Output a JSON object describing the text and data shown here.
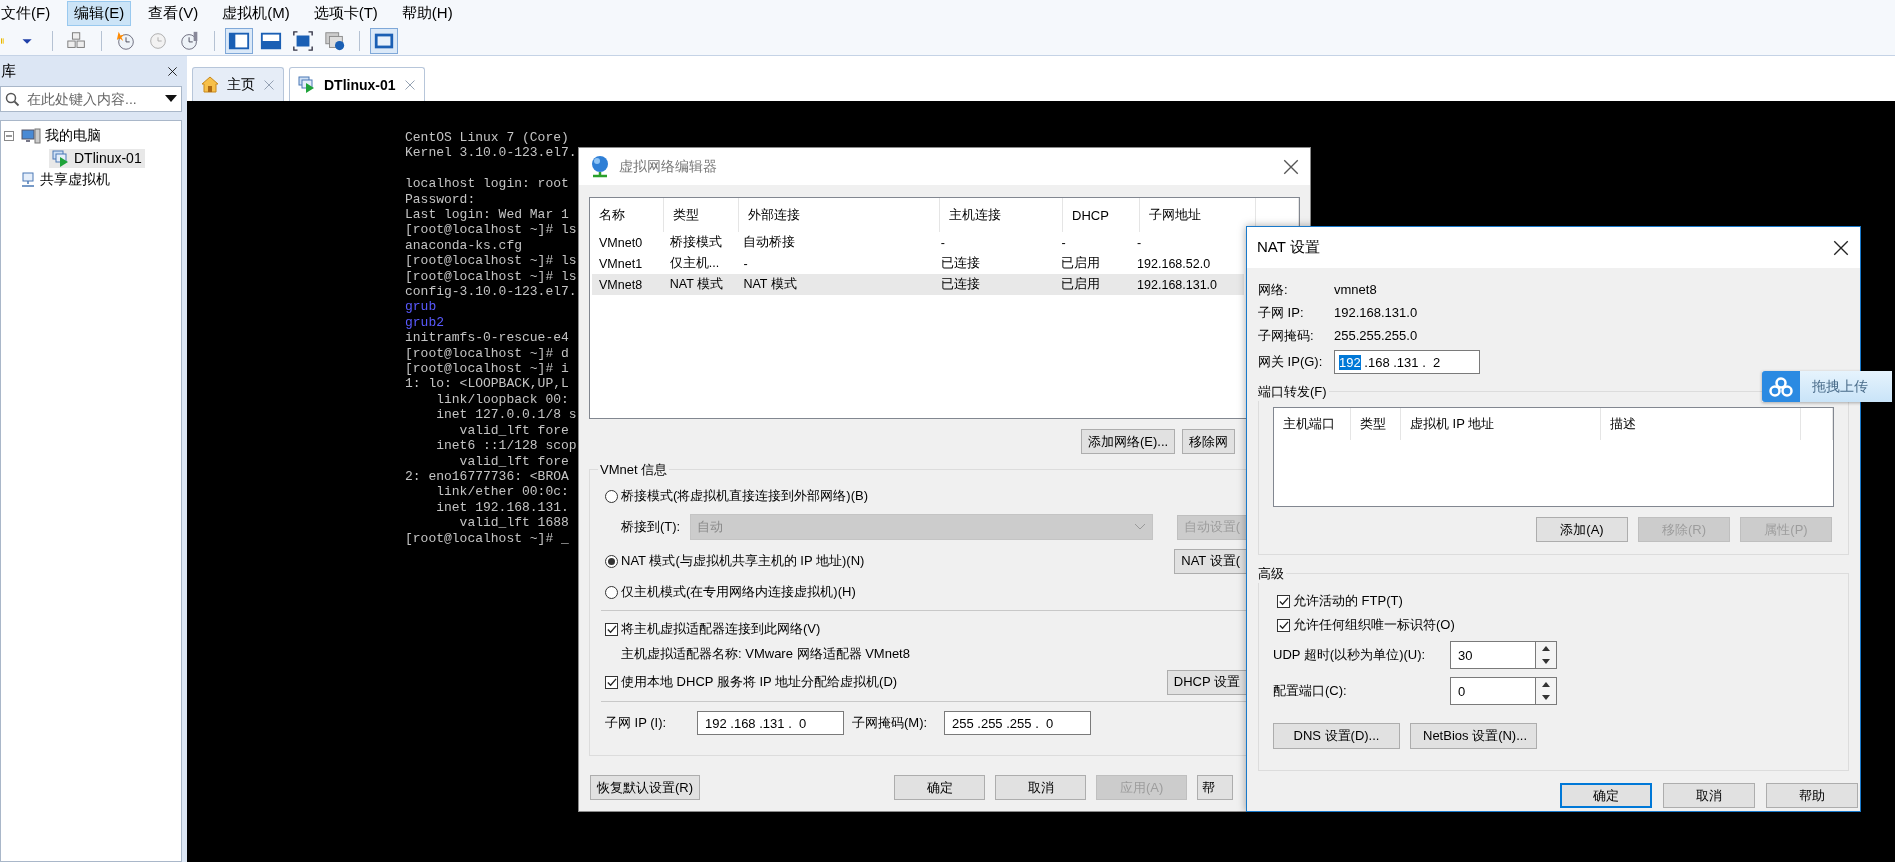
{
  "menu_bar": [
    {
      "label": "文件(F)",
      "selected": false
    },
    {
      "label": "编辑(E)",
      "selected": true
    },
    {
      "label": "查看(V)",
      "selected": false
    },
    {
      "label": "虚拟机(M)",
      "selected": false
    },
    {
      "label": "选项卡(T)",
      "selected": false
    },
    {
      "label": "帮助(H)",
      "selected": false
    }
  ],
  "toolbar": [
    [
      {
        "kind": "pause",
        "pressed": false
      },
      {
        "kind": "caret",
        "pressed": false
      }
    ],
    [
      {
        "kind": "network",
        "pressed": false
      }
    ],
    [
      {
        "kind": "snapshot",
        "pressed": false
      },
      {
        "kind": "revert",
        "pressed": false
      },
      {
        "kind": "manage",
        "pressed": false
      }
    ],
    [
      {
        "kind": "console",
        "pressed": true
      },
      {
        "kind": "split",
        "pressed": false
      },
      {
        "kind": "fullscreen",
        "pressed": false
      },
      {
        "kind": "unity",
        "pressed": false
      }
    ],
    [
      {
        "kind": "thumbnail",
        "pressed": true
      }
    ]
  ],
  "library": {
    "title": "库",
    "search": {
      "placeholder": "在此处键入内容..."
    },
    "tree": [
      {
        "label": "我的电脑",
        "kind": "computer",
        "selected": false,
        "expanded": true,
        "children": [
          {
            "label": "DTlinux-01",
            "kind": "vm",
            "selected": true
          }
        ]
      },
      {
        "label": "共享虚拟机",
        "kind": "shared",
        "selected": false
      }
    ]
  },
  "tabs": [
    {
      "label": "主页",
      "kind": "home",
      "selected": false
    },
    {
      "label": "DTlinux-01",
      "kind": "vm",
      "selected": true
    }
  ],
  "terminal": {
    "paragraphs": [
      [
        {
          "text": "CentOS Linux 7 (Core)",
          "kind": "text"
        },
        {
          "text": "Kernel 3.10.0-123.el7.",
          "kind": "text"
        }
      ],
      [
        {
          "text": "localhost login: root",
          "kind": "text"
        },
        {
          "text": "Password:",
          "kind": "text"
        },
        {
          "text": "Last login: Wed Mar 1",
          "kind": "text"
        },
        {
          "text": "[root@localhost ~]# ls",
          "kind": "text"
        },
        {
          "text": "anaconda-ks.cfg",
          "kind": "text"
        },
        {
          "text": "[root@localhost ~]# ls",
          "kind": "text"
        },
        {
          "text": "[root@localhost ~]# ls",
          "kind": "text"
        },
        {
          "text": "config-3.10.0-123.el7.",
          "kind": "text"
        },
        {
          "text": "grub",
          "kind": "dir"
        },
        {
          "text": "grub2",
          "kind": "dir"
        },
        {
          "text": "initramfs-0-rescue-e4",
          "kind": "text"
        },
        {
          "text": "[root@localhost ~]# d",
          "kind": "text"
        },
        {
          "text": "[root@localhost ~]# i",
          "kind": "text"
        },
        {
          "text": "1: lo: <LOOPBACK,UP,L",
          "kind": "text"
        },
        {
          "text": "    link/loopback 00:",
          "kind": "text"
        },
        {
          "text": "    inet 127.0.0.1/8 s",
          "kind": "text"
        },
        {
          "text": "       valid_lft fore",
          "kind": "text"
        },
        {
          "text": "    inet6 ::1/128 scop",
          "kind": "text"
        },
        {
          "text": "       valid_lft fore",
          "kind": "text"
        },
        {
          "text": "2: eno16777736: <BROA",
          "kind": "text"
        },
        {
          "text": "    link/ether 00:0c:",
          "kind": "text"
        },
        {
          "text": "    inet 192.168.131.",
          "kind": "text"
        },
        {
          "text": "       valid_lft 1688",
          "kind": "text"
        },
        {
          "text": "[root@localhost ~]# _",
          "kind": "text"
        }
      ]
    ]
  },
  "network_editor": {
    "title": "虚拟网络编辑器",
    "table": {
      "columns": [
        "名称",
        "类型",
        "外部连接",
        "主机连接",
        "DHCP",
        "子网地址"
      ],
      "rows": [
        {
          "cells": [
            "VMnet0",
            "桥接模式",
            "自动桥接",
            "-",
            "-",
            "-"
          ],
          "selected": false
        },
        {
          "cells": [
            "VMnet1",
            "仅主机...",
            "-",
            "已连接",
            "已启用",
            "192.168.52.0"
          ],
          "selected": false
        },
        {
          "cells": [
            "VMnet8",
            "NAT 模式",
            "NAT 模式",
            "已连接",
            "已启用",
            "192.168.131.0"
          ],
          "selected": true
        }
      ]
    },
    "table_buttons": [
      {
        "label": "添加网络(E)...",
        "disabled": false
      },
      {
        "label": "移除网",
        "disabled": false
      }
    ],
    "info": {
      "title": "VMnet 信息",
      "modes": [
        {
          "label": "桥接模式(将虚拟机直接连接到外部网络)(B)",
          "selected": false
        },
        {
          "label": "NAT 模式(与虚拟机共享主机的 IP 地址)(N)",
          "selected": true
        },
        {
          "label": "仅主机模式(在专用网络内连接虚拟机)(H)",
          "selected": false
        }
      ],
      "bridge_to": {
        "label": "桥接到(T):",
        "value": "自动",
        "disabled": true
      },
      "bridge_button": {
        "label": "自动设置(",
        "disabled": true
      },
      "nat_button": {
        "label": "NAT 设置(",
        "disabled": false
      },
      "connect_adapter": {
        "label": "将主机虚拟适配器连接到此网络(V)",
        "checked": true
      },
      "adapter_name": {
        "label": "主机虚拟适配器名称:",
        "value": "VMware 网络适配器 VMnet8"
      },
      "use_dhcp": {
        "label": "使用本地 DHCP 服务将 IP 地址分配给虚拟机(D)",
        "checked": true
      },
      "dhcp_button": {
        "label": "DHCP 设置",
        "disabled": false
      },
      "subnet_ip": {
        "label": "子网 IP (I):",
        "value": "192 .168 .131 .  0"
      },
      "subnet_mask": {
        "label": "子网掩码(M):",
        "value": "255 .255 .255 .  0"
      }
    },
    "footer_buttons": [
      {
        "label": "恢复默认设置(R)",
        "disabled": false
      },
      {
        "label": "确定",
        "disabled": false
      },
      {
        "label": "取消",
        "disabled": false
      },
      {
        "label": "应用(A)",
        "disabled": true
      },
      {
        "label": "帮",
        "disabled": false
      }
    ]
  },
  "nat_settings": {
    "title": "NAT 设置",
    "info": [
      {
        "label": "网络:",
        "value": "vmnet8"
      },
      {
        "label": "子网 IP:",
        "value": "192.168.131.0"
      },
      {
        "label": "子网掩码:",
        "value": "255.255.255.0"
      }
    ],
    "gateway": {
      "label": "网关 IP(G):",
      "octets": [
        {
          "text": "192",
          "selected": true
        },
        {
          "text": " .168",
          "selected": false
        },
        {
          "text": " .131",
          "selected": false
        },
        {
          "text": " .  2",
          "selected": false
        }
      ]
    },
    "port_forwarding": {
      "title": "端口转发(F)",
      "columns": [
        "主机端口",
        "类型",
        "虚拟机 IP 地址",
        "描述"
      ],
      "buttons": [
        {
          "label": "添加(A)",
          "disabled": false
        },
        {
          "label": "移除(R)",
          "disabled": true
        },
        {
          "label": "属性(P)",
          "disabled": true
        }
      ]
    },
    "advanced": {
      "title": "高级",
      "options": [
        {
          "label": "允许活动的 FTP(T)",
          "checked": true
        },
        {
          "label": "允许任何组织唯一标识符(O)",
          "checked": true
        }
      ],
      "spinners": [
        {
          "label": "UDP 超时(以秒为单位)(U):",
          "value": "30"
        },
        {
          "label": "配置端口(C):",
          "value": "0"
        }
      ],
      "buttons": [
        {
          "label": "DNS 设置(D)...",
          "disabled": false
        },
        {
          "label": "NetBios 设置(N)...",
          "disabled": false
        }
      ]
    },
    "footer_buttons": [
      {
        "label": "确定",
        "default": true
      },
      {
        "label": "取消",
        "default": false
      },
      {
        "label": "帮助",
        "default": false
      }
    ]
  },
  "upload_widget": {
    "label": "拖拽上传"
  }
}
